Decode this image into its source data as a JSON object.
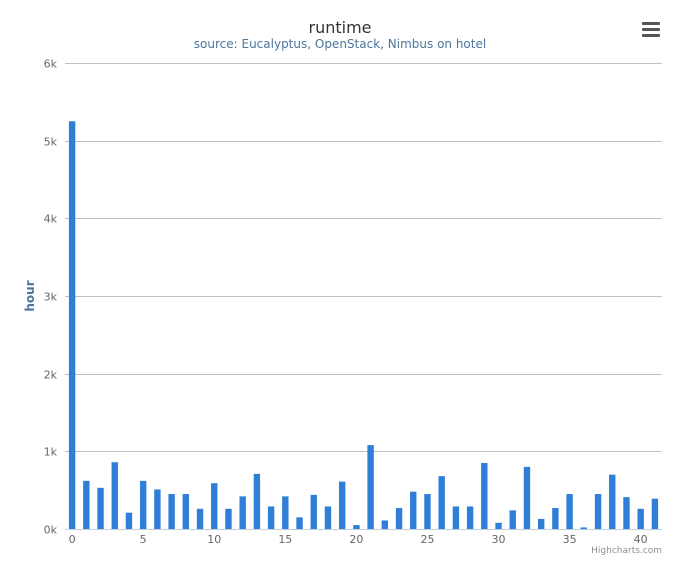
{
  "chart_data": {
    "type": "bar",
    "title": "runtime",
    "subtitle": "source: Eucalyptus, OpenStack, Nimbus on hotel",
    "ylabel": "hour",
    "xlabel": "",
    "ylim": [
      0,
      6000
    ],
    "yticks": [
      0,
      1000,
      2000,
      3000,
      4000,
      5000,
      6000
    ],
    "ytick_labels": [
      "0k",
      "1k",
      "2k",
      "3k",
      "4k",
      "5k",
      "6k"
    ],
    "xlim": [
      -0.5,
      41.5
    ],
    "xticks": [
      0,
      5,
      10,
      15,
      20,
      25,
      30,
      35,
      40
    ],
    "xtick_labels": [
      "0",
      "5",
      "10",
      "15",
      "20",
      "25",
      "30",
      "35",
      "40"
    ],
    "grid": true,
    "color": "#2f7ed8",
    "x": [
      0,
      1,
      2,
      3,
      4,
      5,
      6,
      7,
      8,
      9,
      10,
      11,
      12,
      13,
      14,
      15,
      16,
      17,
      18,
      19,
      20,
      21,
      22,
      23,
      24,
      25,
      26,
      27,
      28,
      29,
      30,
      31,
      32,
      33,
      34,
      35,
      36,
      37,
      38,
      39,
      40,
      41
    ],
    "values": [
      5250,
      620,
      530,
      860,
      210,
      620,
      510,
      450,
      450,
      260,
      590,
      260,
      420,
      710,
      290,
      420,
      150,
      440,
      290,
      610,
      50,
      1080,
      110,
      270,
      480,
      450,
      680,
      290,
      290,
      850,
      80,
      240,
      800,
      130,
      270,
      450,
      20,
      450,
      700,
      410,
      260,
      390
    ]
  },
  "credits": "Highcharts.com",
  "menu": {
    "icon": "menu-icon"
  }
}
